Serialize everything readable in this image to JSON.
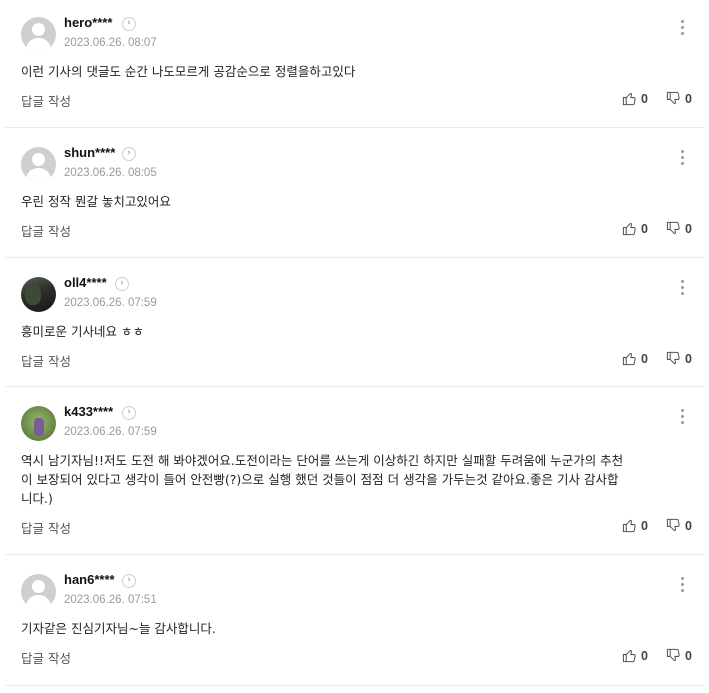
{
  "comments": [
    {
      "nick": "hero****",
      "date": "2023.06.26. 08:07",
      "text": "이런 기사의 댓글도 순간 나도모르게 공감순으로 정렬을하고있다",
      "reply_label": "답글 작성",
      "likes": "0",
      "dislikes": "0",
      "avatar": "default-avatar"
    },
    {
      "nick": "shun****",
      "date": "2023.06.26. 08:05",
      "text": "우린 정작 뭔갈 놓치고있어요",
      "reply_label": "답글 작성",
      "likes": "0",
      "dislikes": "0",
      "avatar": "default-avatar"
    },
    {
      "nick": "oll4****",
      "date": "2023.06.26. 07:59",
      "text": "흥미로운 기사네요 ㅎㅎ",
      "reply_label": "답글 작성",
      "likes": "0",
      "dislikes": "0",
      "avatar": "photo-avatar"
    },
    {
      "nick": "k433****",
      "date": "2023.06.26. 07:59",
      "text_lines": [
        "역시 남기자님!!저도 도전 해 봐야겠어요.도전이라는 단어를 쓰는게 이상하긴 하지만 실패할 두려움에 누군가의 추천",
        "이 보장되어 있다고 생각이 들어 안전빵(?)으로 실행 했던 것들이 점점 더 생각을 가두는것 같아요.좋은 기사 감사합",
        "니다.)"
      ],
      "reply_label": "답글 작성",
      "likes": "0",
      "dislikes": "0",
      "avatar": "photo-avatar"
    },
    {
      "nick": "han6****",
      "date": "2023.06.26. 07:51",
      "text": "기자같은 진심기자님~늘 감사합니다.",
      "reply_label": "답글 작성",
      "likes": "0",
      "dislikes": "0",
      "avatar": "default-avatar"
    }
  ],
  "icons": {
    "profile_link": "chevron-right-icon",
    "more": "more-vertical-icon",
    "like": "thumbs-up-icon",
    "dislike": "thumbs-down-icon"
  },
  "colors": {
    "text": "#222222",
    "meta": "#9a9a9a",
    "divider": "#ececec",
    "avatar_bg": "#cfcfcf"
  }
}
